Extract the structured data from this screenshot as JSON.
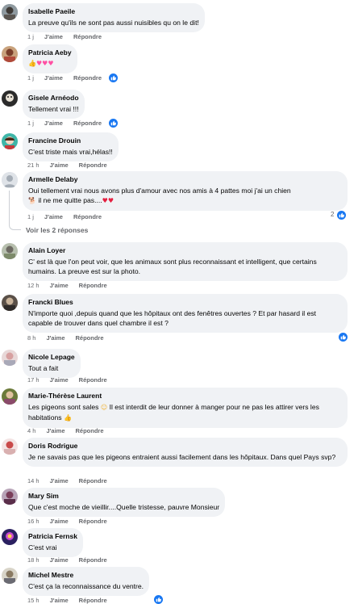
{
  "labels": {
    "like": "J'aime",
    "reply": "Répondre"
  },
  "comments": [
    {
      "name": "Isabelle Paeile",
      "text": "La preuve qu'ils ne sont pas aussi nuisibles qu on le dit!",
      "time": "1 j",
      "reactions": ""
    },
    {
      "name": "Patricia Aeby",
      "text": "",
      "emoji": [
        "thumbs-up",
        "pink-heart",
        "pink-heart",
        "pink-heart"
      ],
      "time": "1 j",
      "reactions": "",
      "has_like_reaction": true
    },
    {
      "name": "Gisele Arnéodo",
      "text": "Tellement vrai !!!",
      "time": "1 j",
      "reactions": "",
      "has_like_reaction": true
    },
    {
      "name": "Francine Drouin",
      "text": "C'est triste mais vrai,hélas!!",
      "time": "21 h",
      "reactions": ""
    },
    {
      "name": "Armelle Delaby",
      "text": "Oui tellement vrai nous avons plus d'amour avec nos amis à 4 pattes moi j'ai un chien",
      "text2": "il ne me quitte pas....",
      "time": "1 j",
      "reactions": "2",
      "has_like_reaction": true
    },
    {
      "name": "Alain Loyer",
      "text": "C' est là que l'on peut voir, que les animaux sont plus reconnaissant et intelligent, que certains humains. La preuve est sur la photo.",
      "time": "12 h",
      "reactions": ""
    },
    {
      "name": "Francki Blues",
      "text": "N'importe quoi ,depuis quand que les hôpitaux ont des fenêtres ouvertes ? Et par hasard il est capable de trouver dans quel chambre il est ?",
      "time": "8 h",
      "reactions": "",
      "has_like_reaction": true
    },
    {
      "name": "Nicole Lepage",
      "text": "Tout a fait",
      "time": "17 h",
      "reactions": ""
    },
    {
      "name": "Marie-Thérèse Laurent",
      "text": "Les pigeons sont sales",
      "text2": "Il est interdit de leur donner à manger pour ne pas les attirer vers les habitations",
      "time": "4 h",
      "reactions": ""
    },
    {
      "name": "Doris Rodrigue",
      "text": "Je ne savais pas que les pigeons entraient aussi facilement dans les hôpitaux. Dans quel Pays svp?",
      "time": "14 h",
      "reactions": ""
    },
    {
      "name": "Mary Sim",
      "text": "Que c'est moche de vieillir....Quelle tristesse, pauvre Monsieur",
      "time": "16 h",
      "reactions": ""
    },
    {
      "name": "Patricia Fernsk",
      "text": "C'est vrai",
      "time": "18 h",
      "reactions": ""
    },
    {
      "name": "Michel Mestre",
      "text": "C'est ça la reconnaissance du ventre.",
      "time": "15 h",
      "reactions": "",
      "has_like_reaction": true
    }
  ],
  "view_replies": "Voir les 2 réponses",
  "colors": {
    "bubble": "#f0f2f5",
    "meta": "#65676b",
    "like_blue": "#1877f2"
  }
}
